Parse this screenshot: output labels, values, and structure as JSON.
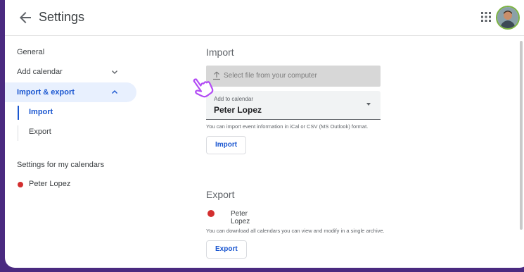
{
  "header": {
    "title": "Settings"
  },
  "sidebar": {
    "items": [
      {
        "label": "General"
      },
      {
        "label": "Add calendar"
      },
      {
        "label": "Import & export"
      }
    ],
    "sub_items": [
      {
        "label": "Import"
      },
      {
        "label": "Export"
      }
    ],
    "my_calendars_title": "Settings for my calendars",
    "my_calendars": [
      {
        "label": "Peter Lopez",
        "color": "#d32f2f"
      }
    ]
  },
  "import": {
    "heading": "Import",
    "file_label": "Select file from your computer",
    "calendar_label": "Add to calendar",
    "calendar_value": "Peter Lopez",
    "note": "You can import event information in iCal or CSV (MS Outlook) format.",
    "button": "Import"
  },
  "export": {
    "heading": "Export",
    "calendar_name": "Peter Lopez",
    "calendar_color": "#d32f2f",
    "note": "You can download all calendars you can view and modify in a single archive.",
    "button": "Export"
  },
  "colors": {
    "accent": "#1a56d0",
    "active_bg": "#e8f0fe",
    "frame_bg": "#4a2a80",
    "cursor_accent": "#b34df5"
  },
  "icons": [
    "back-arrow-icon",
    "apps-grid-icon",
    "chevron-down-icon",
    "chevron-up-icon",
    "upload-icon",
    "dropdown-arrow-icon",
    "pointer-hand-icon"
  ]
}
